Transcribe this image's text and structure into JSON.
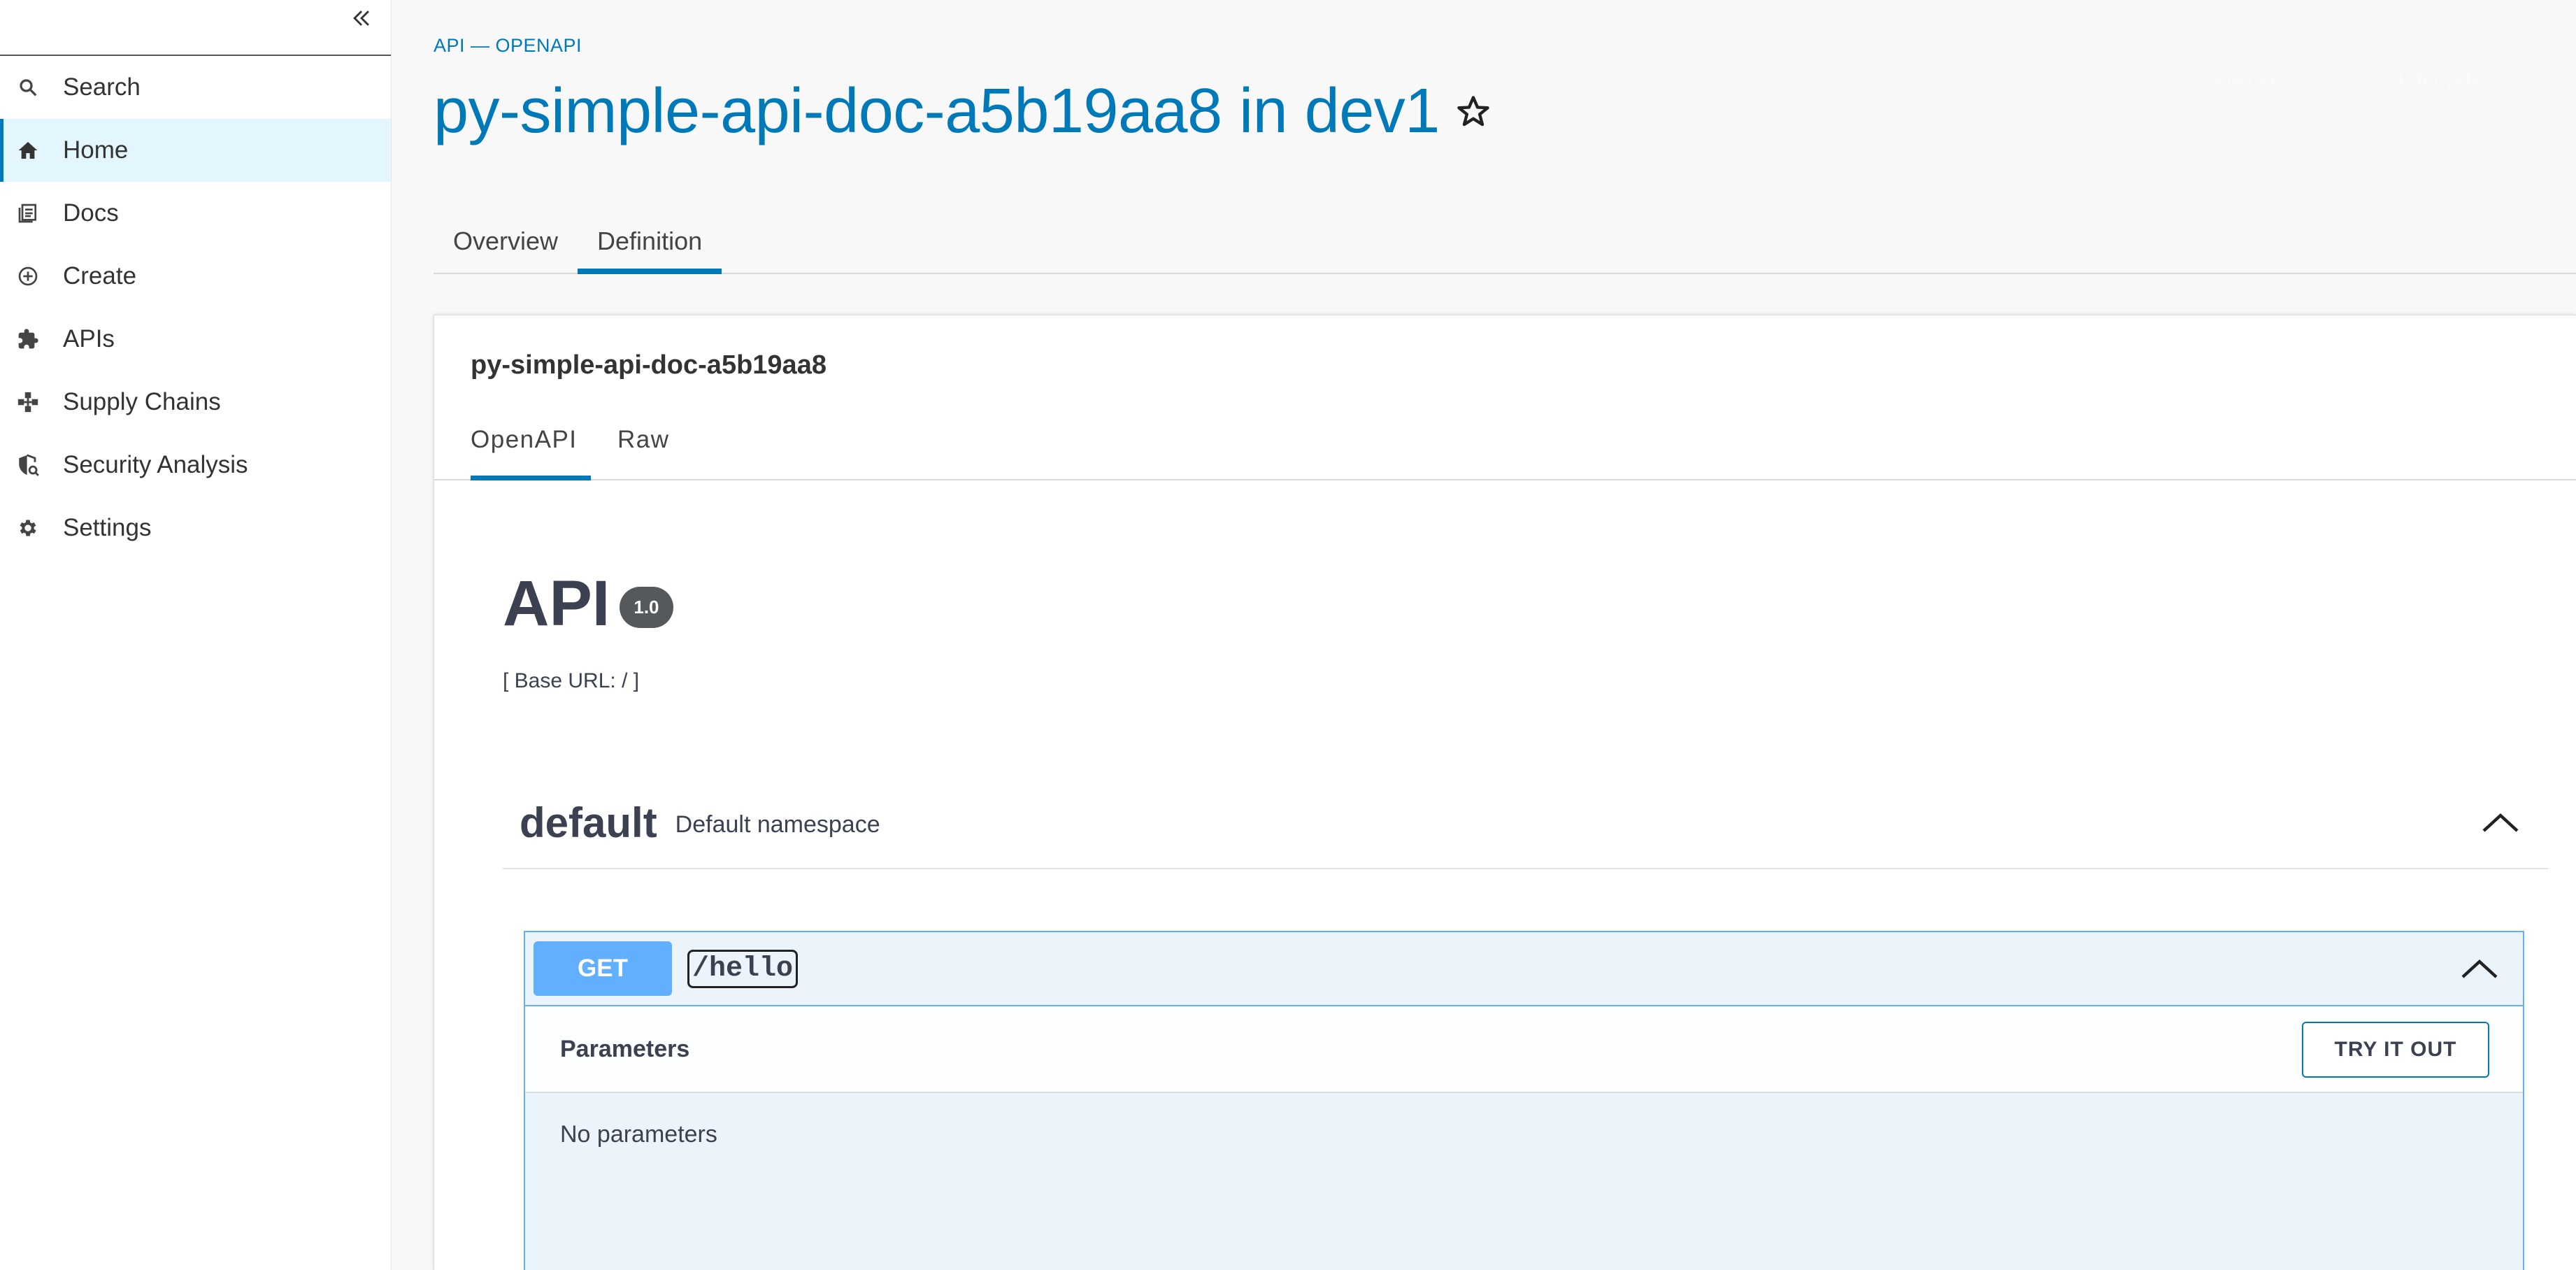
{
  "sidebar": {
    "items": [
      {
        "label": "Search",
        "icon": "search-icon"
      },
      {
        "label": "Home",
        "icon": "home-icon",
        "active": true
      },
      {
        "label": "Docs",
        "icon": "docs-icon"
      },
      {
        "label": "Create",
        "icon": "create-icon"
      },
      {
        "label": "APIs",
        "icon": "puzzle-icon"
      },
      {
        "label": "Supply Chains",
        "icon": "supply-chain-icon"
      },
      {
        "label": "Security Analysis",
        "icon": "security-analysis-icon"
      },
      {
        "label": "Settings",
        "icon": "gear-icon"
      }
    ]
  },
  "header": {
    "breadcrumb": "API — OPENAPI",
    "title": "py-simple-api-doc-a5b19aa8 in dev1",
    "owner_label": "Owner",
    "lifecycle_label": "Lifecycle"
  },
  "tabs": [
    "Overview",
    "Definition"
  ],
  "card": {
    "title": "py-simple-api-doc-a5b19aa8",
    "subtabs": [
      "OpenAPI",
      "Raw"
    ]
  },
  "openapi": {
    "api_title": "API",
    "version": "1.0",
    "base_url": "[ Base URL: / ]",
    "namespace": {
      "name": "default",
      "description": "Default namespace"
    },
    "operation": {
      "method": "GET",
      "path": "/hello"
    },
    "parameters_title": "Parameters",
    "try_button": "TRY IT OUT",
    "no_params": "No parameters"
  },
  "colors": {
    "accent": "#0079b8",
    "get_method": "#61affe",
    "active_nav_bg": "#e3f5fd"
  }
}
